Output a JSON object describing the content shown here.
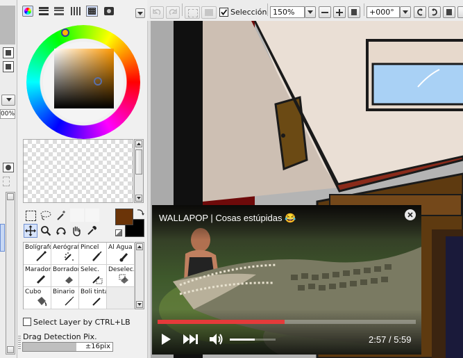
{
  "toolbar": {
    "selection_label": "Selección",
    "selection_checked": true,
    "zoom_value": "150%",
    "rotation_value": "+000°"
  },
  "left_strip": {
    "percent_label": "00%"
  },
  "color_panel": {
    "primary_color": "#6b3408",
    "secondary_color": "#000000"
  },
  "options": {
    "select_layer_label": "Select Layer by CTRL+LB",
    "drag_detection_label": "Drag Detection Pix.",
    "drag_detection_value": "±16pix"
  },
  "brushes": [
    {
      "label": "Bolígrafo",
      "icon": "pen-icon"
    },
    {
      "label": "Aerógrafo",
      "icon": "airbrush-icon"
    },
    {
      "label": "Pincel",
      "icon": "brush-icon"
    },
    {
      "label": "Al Agua",
      "icon": "watercolor-icon"
    },
    {
      "label": "Marador",
      "icon": "marker-icon"
    },
    {
      "label": "Borrador",
      "icon": "eraser-icon"
    },
    {
      "label": "Selec.",
      "icon": "select-pen-icon"
    },
    {
      "label": "Deselec.",
      "icon": "deselect-pen-icon"
    },
    {
      "label": "Cubo",
      "icon": "bucket-icon"
    },
    {
      "label": "Binario",
      "icon": "binary-icon"
    },
    {
      "label": "Boli tinta",
      "icon": "ink-pen-icon"
    },
    {
      "label": "",
      "icon": ""
    }
  ],
  "video": {
    "title": "WALLAPOP | Cosas estúpidas 😂",
    "current_time": "2:57",
    "separator": "/",
    "duration": "5:59",
    "progress": 0.493,
    "volume": 0.55
  }
}
